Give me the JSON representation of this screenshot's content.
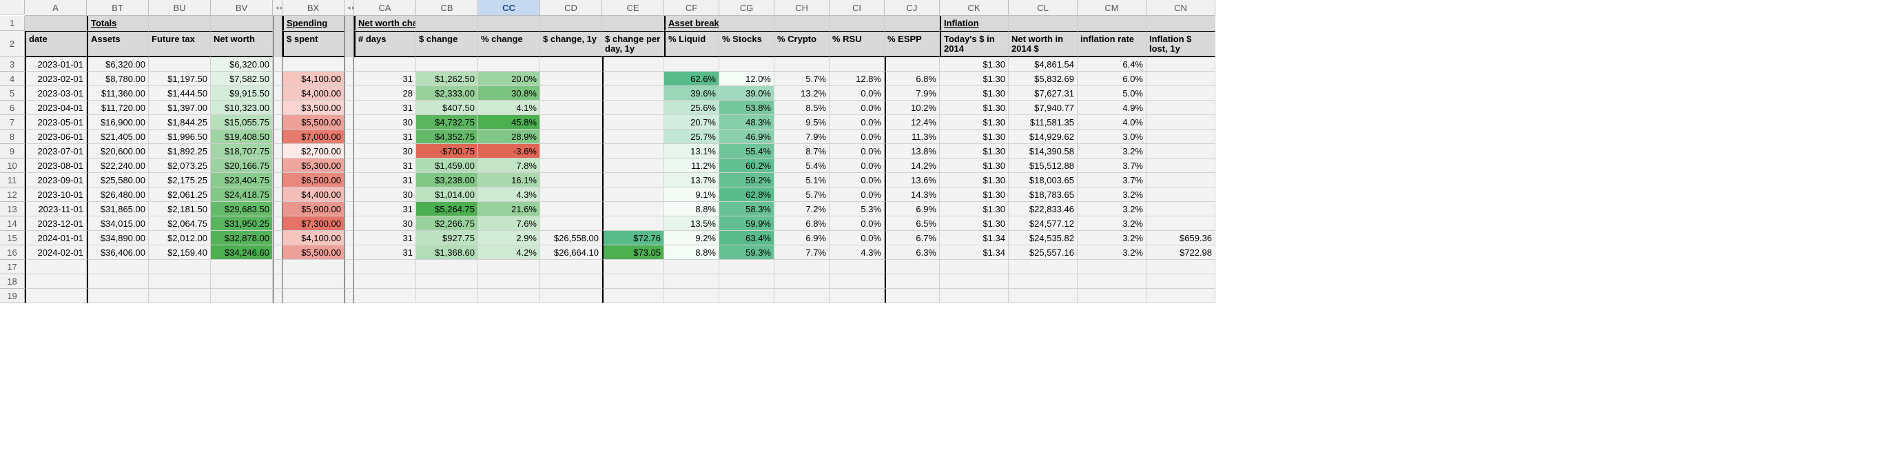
{
  "columns": [
    "",
    "A",
    "BT",
    "BU",
    "BV",
    "",
    "BX",
    "",
    "CA",
    "CB",
    "CC",
    "CD",
    "CE",
    "CF",
    "CG",
    "CH",
    "CI",
    "CJ",
    "CK",
    "CL",
    "CM",
    "CN"
  ],
  "selected_col_index": 10,
  "categories": {
    "totals": "Totals",
    "spending": "Spending",
    "nwchange": "Net worth change",
    "asset": "Asset breakdown",
    "inflation": "Inflation"
  },
  "headers": {
    "date": "date",
    "assets": "Assets",
    "future_tax": "Future tax",
    "net_worth": "Net worth",
    "spent": "$ spent",
    "days": "# days",
    "dchange": "$ change",
    "pchange": "% change",
    "dchange1y": "$ change, 1y",
    "dchangeperday": "$ change per day, 1y",
    "liquid": "% Liquid",
    "stocks": "% Stocks",
    "crypto": "% Crypto",
    "rsu": "% RSU",
    "espp": "% ESPP",
    "today2014": "Today's $ in 2014",
    "nw2014": "Net worth in 2014 $",
    "inflrate": "inflation rate",
    "infllost": "Inflation $ lost, 1y"
  },
  "rows": [
    {
      "n": 3,
      "date": "2023-01-01",
      "assets": "$6,320.00",
      "tax": "",
      "nw": "$6,320.00",
      "spent": "",
      "days": "",
      "dc": "",
      "pc": "",
      "dc1": "",
      "dcd": "",
      "liq": "",
      "stk": "",
      "cry": "",
      "rsu": "",
      "esp": "",
      "t14": "$1.30",
      "nw14": "$4,861.54",
      "ir": "6.4%",
      "il": ""
    },
    {
      "n": 4,
      "date": "2023-02-01",
      "assets": "$8,780.00",
      "tax": "$1,197.50",
      "nw": "$7,582.50",
      "spent": "$4,100.00",
      "days": "31",
      "dc": "$1,262.50",
      "pc": "20.0%",
      "dc1": "",
      "dcd": "",
      "liq": "62.6%",
      "stk": "12.0%",
      "cry": "5.7%",
      "rsu": "12.8%",
      "esp": "6.8%",
      "t14": "$1.30",
      "nw14": "$5,832.69",
      "ir": "6.0%",
      "il": ""
    },
    {
      "n": 5,
      "date": "2023-03-01",
      "assets": "$11,360.00",
      "tax": "$1,444.50",
      "nw": "$9,915.50",
      "spent": "$4,000.00",
      "days": "28",
      "dc": "$2,333.00",
      "pc": "30.8%",
      "dc1": "",
      "dcd": "",
      "liq": "39.6%",
      "stk": "39.0%",
      "cry": "13.2%",
      "rsu": "0.0%",
      "esp": "7.9%",
      "t14": "$1.30",
      "nw14": "$7,627.31",
      "ir": "5.0%",
      "il": ""
    },
    {
      "n": 6,
      "date": "2023-04-01",
      "assets": "$11,720.00",
      "tax": "$1,397.00",
      "nw": "$10,323.00",
      "spent": "$3,500.00",
      "days": "31",
      "dc": "$407.50",
      "pc": "4.1%",
      "dc1": "",
      "dcd": "",
      "liq": "25.6%",
      "stk": "53.8%",
      "cry": "8.5%",
      "rsu": "0.0%",
      "esp": "10.2%",
      "t14": "$1.30",
      "nw14": "$7,940.77",
      "ir": "4.9%",
      "il": ""
    },
    {
      "n": 7,
      "date": "2023-05-01",
      "assets": "$16,900.00",
      "tax": "$1,844.25",
      "nw": "$15,055.75",
      "spent": "$5,500.00",
      "days": "30",
      "dc": "$4,732.75",
      "pc": "45.8%",
      "dc1": "",
      "dcd": "",
      "liq": "20.7%",
      "stk": "48.3%",
      "cry": "9.5%",
      "rsu": "0.0%",
      "esp": "12.4%",
      "t14": "$1.30",
      "nw14": "$11,581.35",
      "ir": "4.0%",
      "il": ""
    },
    {
      "n": 8,
      "date": "2023-06-01",
      "assets": "$21,405.00",
      "tax": "$1,996.50",
      "nw": "$19,408.50",
      "spent": "$7,000.00",
      "days": "31",
      "dc": "$4,352.75",
      "pc": "28.9%",
      "dc1": "",
      "dcd": "",
      "liq": "25.7%",
      "stk": "46.9%",
      "cry": "7.9%",
      "rsu": "0.0%",
      "esp": "11.3%",
      "t14": "$1.30",
      "nw14": "$14,929.62",
      "ir": "3.0%",
      "il": ""
    },
    {
      "n": 9,
      "date": "2023-07-01",
      "assets": "$20,600.00",
      "tax": "$1,892.25",
      "nw": "$18,707.75",
      "spent": "$2,700.00",
      "days": "30",
      "dc": "-$700.75",
      "pc": "-3.6%",
      "dc1": "",
      "dcd": "",
      "liq": "13.1%",
      "stk": "55.4%",
      "cry": "8.7%",
      "rsu": "0.0%",
      "esp": "13.8%",
      "t14": "$1.30",
      "nw14": "$14,390.58",
      "ir": "3.2%",
      "il": ""
    },
    {
      "n": 10,
      "date": "2023-08-01",
      "assets": "$22,240.00",
      "tax": "$2,073.25",
      "nw": "$20,166.75",
      "spent": "$5,300.00",
      "days": "31",
      "dc": "$1,459.00",
      "pc": "7.8%",
      "dc1": "",
      "dcd": "",
      "liq": "11.2%",
      "stk": "60.2%",
      "cry": "5.4%",
      "rsu": "0.0%",
      "esp": "14.2%",
      "t14": "$1.30",
      "nw14": "$15,512.88",
      "ir": "3.7%",
      "il": ""
    },
    {
      "n": 11,
      "date": "2023-09-01",
      "assets": "$25,580.00",
      "tax": "$2,175.25",
      "nw": "$23,404.75",
      "spent": "$6,500.00",
      "days": "31",
      "dc": "$3,238.00",
      "pc": "16.1%",
      "dc1": "",
      "dcd": "",
      "liq": "13.7%",
      "stk": "59.2%",
      "cry": "5.1%",
      "rsu": "0.0%",
      "esp": "13.6%",
      "t14": "$1.30",
      "nw14": "$18,003.65",
      "ir": "3.7%",
      "il": ""
    },
    {
      "n": 12,
      "date": "2023-10-01",
      "assets": "$26,480.00",
      "tax": "$2,061.25",
      "nw": "$24,418.75",
      "spent": "$4,400.00",
      "days": "30",
      "dc": "$1,014.00",
      "pc": "4.3%",
      "dc1": "",
      "dcd": "",
      "liq": "9.1%",
      "stk": "62.8%",
      "cry": "5.7%",
      "rsu": "0.0%",
      "esp": "14.3%",
      "t14": "$1.30",
      "nw14": "$18,783.65",
      "ir": "3.2%",
      "il": ""
    },
    {
      "n": 13,
      "date": "2023-11-01",
      "assets": "$31,865.00",
      "tax": "$2,181.50",
      "nw": "$29,683.50",
      "spent": "$5,900.00",
      "days": "31",
      "dc": "$5,264.75",
      "pc": "21.6%",
      "dc1": "",
      "dcd": "",
      "liq": "8.8%",
      "stk": "58.3%",
      "cry": "7.2%",
      "rsu": "5.3%",
      "esp": "6.9%",
      "t14": "$1.30",
      "nw14": "$22,833.46",
      "ir": "3.2%",
      "il": ""
    },
    {
      "n": 14,
      "date": "2023-12-01",
      "assets": "$34,015.00",
      "tax": "$2,064.75",
      "nw": "$31,950.25",
      "spent": "$7,300.00",
      "days": "30",
      "dc": "$2,266.75",
      "pc": "7.6%",
      "dc1": "",
      "dcd": "",
      "liq": "13.5%",
      "stk": "59.9%",
      "cry": "6.8%",
      "rsu": "0.0%",
      "esp": "6.5%",
      "t14": "$1.30",
      "nw14": "$24,577.12",
      "ir": "3.2%",
      "il": ""
    },
    {
      "n": 15,
      "date": "2024-01-01",
      "assets": "$34,890.00",
      "tax": "$2,012.00",
      "nw": "$32,878.00",
      "spent": "$4,100.00",
      "days": "31",
      "dc": "$927.75",
      "pc": "2.9%",
      "dc1": "$26,558.00",
      "dcd": "$72.76",
      "liq": "9.2%",
      "stk": "63.4%",
      "cry": "6.9%",
      "rsu": "0.0%",
      "esp": "6.7%",
      "t14": "$1.34",
      "nw14": "$24,535.82",
      "ir": "3.2%",
      "il": "$659.36"
    },
    {
      "n": 16,
      "date": "2024-02-01",
      "assets": "$36,406.00",
      "tax": "$2,159.40",
      "nw": "$34,246.60",
      "spent": "$5,500.00",
      "days": "31",
      "dc": "$1,368.60",
      "pc": "4.2%",
      "dc1": "$26,664.10",
      "dcd": "$73.05",
      "liq": "8.8%",
      "stk": "59.3%",
      "cry": "7.7%",
      "rsu": "4.3%",
      "esp": "6.3%",
      "t14": "$1.34",
      "nw14": "$25,557.16",
      "ir": "3.2%",
      "il": "$722.98"
    },
    {
      "n": 17,
      "date": "",
      "assets": "",
      "tax": "",
      "nw": "",
      "spent": "",
      "days": "",
      "dc": "",
      "pc": "",
      "dc1": "",
      "dcd": "",
      "liq": "",
      "stk": "",
      "cry": "",
      "rsu": "",
      "esp": "",
      "t14": "",
      "nw14": "",
      "ir": "",
      "il": ""
    },
    {
      "n": 18,
      "date": "",
      "assets": "",
      "tax": "",
      "nw": "",
      "spent": "",
      "days": "",
      "dc": "",
      "pc": "",
      "dc1": "",
      "dcd": "",
      "liq": "",
      "stk": "",
      "cry": "",
      "rsu": "",
      "esp": "",
      "t14": "",
      "nw14": "",
      "ir": "",
      "il": ""
    },
    {
      "n": 19,
      "date": "",
      "assets": "",
      "tax": "",
      "nw": "",
      "spent": "",
      "days": "",
      "dc": "",
      "pc": "",
      "dc1": "",
      "dcd": "",
      "liq": "",
      "stk": "",
      "cry": "",
      "rsu": "",
      "esp": "",
      "t14": "",
      "nw14": "",
      "ir": "",
      "il": ""
    }
  ],
  "heat": {
    "nw": {
      "min": 6320,
      "max": 34247,
      "lo": "#e8f5ec",
      "hi": "#4caf50"
    },
    "spent": {
      "min": 2700,
      "max": 7300,
      "lo": "#fde9e7",
      "hi": "#e57367"
    },
    "dc": {
      "min": -701,
      "max": 5265,
      "neg": "#e06655",
      "lo": "#e8f5ec",
      "hi": "#4caf50"
    },
    "pc": {
      "min": -3.6,
      "max": 45.8,
      "neg": "#e06655",
      "lo": "#e8f5ec",
      "hi": "#4caf50"
    },
    "dcd": {
      "min": 72.76,
      "max": 73.05,
      "lo": "#57bb8a",
      "hi": "#4caf50"
    },
    "liq": {
      "min": 8.8,
      "max": 62.6,
      "lo": "#f5fbf7",
      "hi": "#57bb8a"
    },
    "stk": {
      "min": 12.0,
      "max": 63.4,
      "lo": "#f5fbf7",
      "hi": "#57bb8a"
    }
  }
}
